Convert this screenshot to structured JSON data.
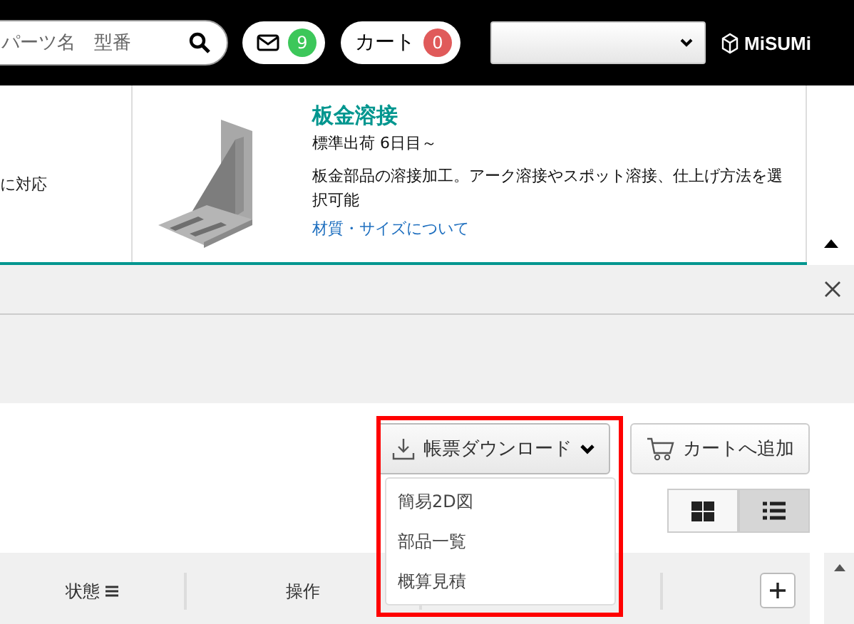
{
  "header": {
    "search": {
      "placeholder": "パーツ名　型番"
    },
    "messages": {
      "count": "9"
    },
    "cart": {
      "label": "カート",
      "count": "0"
    },
    "logo": "MiSUMi"
  },
  "product_band": {
    "left_text": "に対応",
    "product": {
      "title": "板金溶接",
      "shipping": "標準出荷 6日目～",
      "description": "板金部品の溶接加工。アーク溶接やスポット溶接、仕上げ方法を選択可能",
      "link": "材質・サイズについて"
    }
  },
  "toolbar": {
    "download": {
      "label": "帳票ダウンロード",
      "expanded": true,
      "menu": [
        "簡易2D図",
        "部品一覧",
        "概算見積"
      ]
    },
    "add_to_cart": "カートへ追加",
    "views": [
      {
        "kind": "grid",
        "selected": false
      },
      {
        "kind": "list",
        "selected": true
      }
    ]
  },
  "table": {
    "columns": [
      "状態",
      "操作"
    ]
  }
}
